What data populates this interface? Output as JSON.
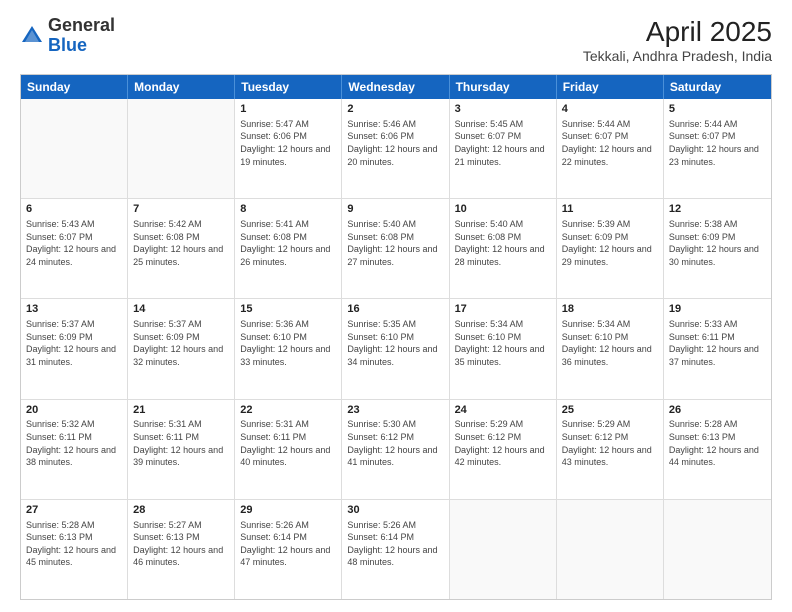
{
  "logo": {
    "general": "General",
    "blue": "Blue"
  },
  "title": "April 2025",
  "subtitle": "Tekkali, Andhra Pradesh, India",
  "header_days": [
    "Sunday",
    "Monday",
    "Tuesday",
    "Wednesday",
    "Thursday",
    "Friday",
    "Saturday"
  ],
  "weeks": [
    [
      {
        "day": "",
        "sunrise": "",
        "sunset": "",
        "daylight": ""
      },
      {
        "day": "",
        "sunrise": "",
        "sunset": "",
        "daylight": ""
      },
      {
        "day": "1",
        "sunrise": "Sunrise: 5:47 AM",
        "sunset": "Sunset: 6:06 PM",
        "daylight": "Daylight: 12 hours and 19 minutes."
      },
      {
        "day": "2",
        "sunrise": "Sunrise: 5:46 AM",
        "sunset": "Sunset: 6:06 PM",
        "daylight": "Daylight: 12 hours and 20 minutes."
      },
      {
        "day": "3",
        "sunrise": "Sunrise: 5:45 AM",
        "sunset": "Sunset: 6:07 PM",
        "daylight": "Daylight: 12 hours and 21 minutes."
      },
      {
        "day": "4",
        "sunrise": "Sunrise: 5:44 AM",
        "sunset": "Sunset: 6:07 PM",
        "daylight": "Daylight: 12 hours and 22 minutes."
      },
      {
        "day": "5",
        "sunrise": "Sunrise: 5:44 AM",
        "sunset": "Sunset: 6:07 PM",
        "daylight": "Daylight: 12 hours and 23 minutes."
      }
    ],
    [
      {
        "day": "6",
        "sunrise": "Sunrise: 5:43 AM",
        "sunset": "Sunset: 6:07 PM",
        "daylight": "Daylight: 12 hours and 24 minutes."
      },
      {
        "day": "7",
        "sunrise": "Sunrise: 5:42 AM",
        "sunset": "Sunset: 6:08 PM",
        "daylight": "Daylight: 12 hours and 25 minutes."
      },
      {
        "day": "8",
        "sunrise": "Sunrise: 5:41 AM",
        "sunset": "Sunset: 6:08 PM",
        "daylight": "Daylight: 12 hours and 26 minutes."
      },
      {
        "day": "9",
        "sunrise": "Sunrise: 5:40 AM",
        "sunset": "Sunset: 6:08 PM",
        "daylight": "Daylight: 12 hours and 27 minutes."
      },
      {
        "day": "10",
        "sunrise": "Sunrise: 5:40 AM",
        "sunset": "Sunset: 6:08 PM",
        "daylight": "Daylight: 12 hours and 28 minutes."
      },
      {
        "day": "11",
        "sunrise": "Sunrise: 5:39 AM",
        "sunset": "Sunset: 6:09 PM",
        "daylight": "Daylight: 12 hours and 29 minutes."
      },
      {
        "day": "12",
        "sunrise": "Sunrise: 5:38 AM",
        "sunset": "Sunset: 6:09 PM",
        "daylight": "Daylight: 12 hours and 30 minutes."
      }
    ],
    [
      {
        "day": "13",
        "sunrise": "Sunrise: 5:37 AM",
        "sunset": "Sunset: 6:09 PM",
        "daylight": "Daylight: 12 hours and 31 minutes."
      },
      {
        "day": "14",
        "sunrise": "Sunrise: 5:37 AM",
        "sunset": "Sunset: 6:09 PM",
        "daylight": "Daylight: 12 hours and 32 minutes."
      },
      {
        "day": "15",
        "sunrise": "Sunrise: 5:36 AM",
        "sunset": "Sunset: 6:10 PM",
        "daylight": "Daylight: 12 hours and 33 minutes."
      },
      {
        "day": "16",
        "sunrise": "Sunrise: 5:35 AM",
        "sunset": "Sunset: 6:10 PM",
        "daylight": "Daylight: 12 hours and 34 minutes."
      },
      {
        "day": "17",
        "sunrise": "Sunrise: 5:34 AM",
        "sunset": "Sunset: 6:10 PM",
        "daylight": "Daylight: 12 hours and 35 minutes."
      },
      {
        "day": "18",
        "sunrise": "Sunrise: 5:34 AM",
        "sunset": "Sunset: 6:10 PM",
        "daylight": "Daylight: 12 hours and 36 minutes."
      },
      {
        "day": "19",
        "sunrise": "Sunrise: 5:33 AM",
        "sunset": "Sunset: 6:11 PM",
        "daylight": "Daylight: 12 hours and 37 minutes."
      }
    ],
    [
      {
        "day": "20",
        "sunrise": "Sunrise: 5:32 AM",
        "sunset": "Sunset: 6:11 PM",
        "daylight": "Daylight: 12 hours and 38 minutes."
      },
      {
        "day": "21",
        "sunrise": "Sunrise: 5:31 AM",
        "sunset": "Sunset: 6:11 PM",
        "daylight": "Daylight: 12 hours and 39 minutes."
      },
      {
        "day": "22",
        "sunrise": "Sunrise: 5:31 AM",
        "sunset": "Sunset: 6:11 PM",
        "daylight": "Daylight: 12 hours and 40 minutes."
      },
      {
        "day": "23",
        "sunrise": "Sunrise: 5:30 AM",
        "sunset": "Sunset: 6:12 PM",
        "daylight": "Daylight: 12 hours and 41 minutes."
      },
      {
        "day": "24",
        "sunrise": "Sunrise: 5:29 AM",
        "sunset": "Sunset: 6:12 PM",
        "daylight": "Daylight: 12 hours and 42 minutes."
      },
      {
        "day": "25",
        "sunrise": "Sunrise: 5:29 AM",
        "sunset": "Sunset: 6:12 PM",
        "daylight": "Daylight: 12 hours and 43 minutes."
      },
      {
        "day": "26",
        "sunrise": "Sunrise: 5:28 AM",
        "sunset": "Sunset: 6:13 PM",
        "daylight": "Daylight: 12 hours and 44 minutes."
      }
    ],
    [
      {
        "day": "27",
        "sunrise": "Sunrise: 5:28 AM",
        "sunset": "Sunset: 6:13 PM",
        "daylight": "Daylight: 12 hours and 45 minutes."
      },
      {
        "day": "28",
        "sunrise": "Sunrise: 5:27 AM",
        "sunset": "Sunset: 6:13 PM",
        "daylight": "Daylight: 12 hours and 46 minutes."
      },
      {
        "day": "29",
        "sunrise": "Sunrise: 5:26 AM",
        "sunset": "Sunset: 6:14 PM",
        "daylight": "Daylight: 12 hours and 47 minutes."
      },
      {
        "day": "30",
        "sunrise": "Sunrise: 5:26 AM",
        "sunset": "Sunset: 6:14 PM",
        "daylight": "Daylight: 12 hours and 48 minutes."
      },
      {
        "day": "",
        "sunrise": "",
        "sunset": "",
        "daylight": ""
      },
      {
        "day": "",
        "sunrise": "",
        "sunset": "",
        "daylight": ""
      },
      {
        "day": "",
        "sunrise": "",
        "sunset": "",
        "daylight": ""
      }
    ]
  ]
}
